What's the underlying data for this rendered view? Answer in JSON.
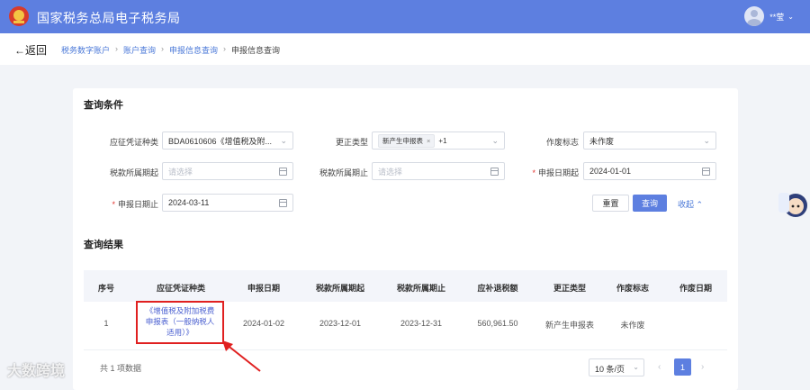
{
  "header": {
    "title": "国家税务总局电子税务局",
    "user_name": "**莹",
    "user_caret": "⌄"
  },
  "nav": {
    "back_label": "返回",
    "breadcrumbs": [
      "税务数字账户",
      "账户查询",
      "申报信息查询"
    ],
    "current": "申报信息查询",
    "separator": "›"
  },
  "query": {
    "title": "查询条件",
    "fields": {
      "voucher_type": {
        "label": "应征凭证种类",
        "value": "BDA0610606《增值税及附..."
      },
      "correction_type": {
        "label": "更正类型",
        "tag": "新产生申报表",
        "tag_close": "×",
        "more": "+1"
      },
      "void_flag": {
        "label": "作废标志",
        "value": "未作废"
      },
      "tax_period_start": {
        "label": "税款所属期起",
        "placeholder": "请选择"
      },
      "tax_period_end": {
        "label": "税款所属期止",
        "placeholder": "请选择"
      },
      "declare_date_start": {
        "label": "申报日期起",
        "required": "*",
        "value": "2024-01-01"
      },
      "declare_date_end": {
        "label": "申报日期止",
        "required": "*",
        "value": "2024-03-11"
      }
    },
    "buttons": {
      "reset": "重置",
      "query": "查询",
      "collapse": "收起"
    }
  },
  "results": {
    "title": "查询结果",
    "columns": [
      "序号",
      "应征凭证种类",
      "申报日期",
      "税款所属期起",
      "税款所属期止",
      "应补退税额",
      "更正类型",
      "作废标志",
      "作废日期"
    ],
    "rows": [
      {
        "index": "1",
        "voucher_line1": "《增值税及附加税费",
        "voucher_line2": "申报表（一般纳税人",
        "voucher_line3": "适用）》",
        "declare_date": "2024-01-02",
        "period_start": "2023-12-01",
        "period_end": "2023-12-31",
        "amount": "560,961.50",
        "correction": "新产生申报表",
        "void_flag": "未作废",
        "void_date": ""
      }
    ],
    "total": "共 1 项数据",
    "page_size": "10 条/页",
    "current_page": "1",
    "prev": "‹",
    "next": "›"
  },
  "watermark": "大数跨境",
  "colors": {
    "primary": "#5d7fe0",
    "link": "#4a78d8",
    "highlight_border": "#e02020"
  }
}
